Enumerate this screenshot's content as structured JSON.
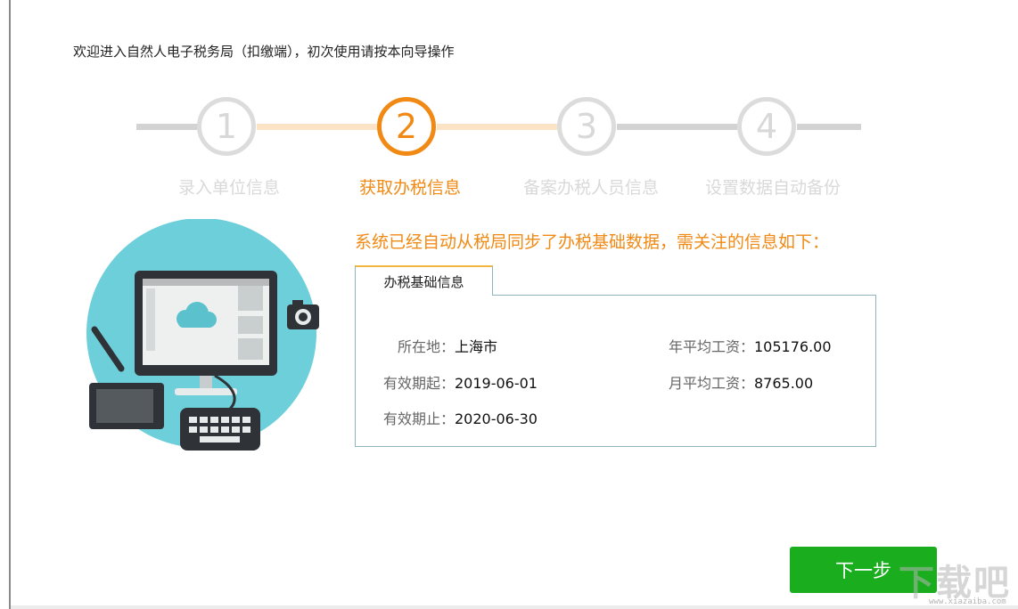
{
  "header": {
    "welcome": "欢迎进入自然人电子税务局（扣缴端），初次使用请按本向导操作"
  },
  "wizard": {
    "steps": [
      {
        "number": "1",
        "label": "录入单位信息",
        "state": "done"
      },
      {
        "number": "2",
        "label": "获取办税信息",
        "state": "active"
      },
      {
        "number": "3",
        "label": "备案办税人员信息",
        "state": "pending"
      },
      {
        "number": "4",
        "label": "设置数据自动备份",
        "state": "pending"
      }
    ],
    "colors": {
      "active": "#f08a15",
      "inactive": "#dcdcdc",
      "progress_line": "#fde3c6",
      "line": "#d3d3d3"
    }
  },
  "notice": "系统已经自动从税局同步了办税基础数据，需关注的信息如下：",
  "panel": {
    "tab_label": "办税基础信息",
    "fields": [
      {
        "key": "所在地：",
        "value": "上海市"
      },
      {
        "key": "有效期起：",
        "value": "2019-06-01"
      },
      {
        "key": "有效期止：",
        "value": "2020-06-30"
      },
      {
        "key": "年平均工资：",
        "value": "105176.00"
      },
      {
        "key": "月平均工资：",
        "value": "8765.00"
      }
    ]
  },
  "footer": {
    "next_label": "下一步",
    "next_color": "#1aae1f"
  },
  "watermark": {
    "text": "下载吧",
    "url": "www.xiazaiba.com"
  },
  "icons": [
    "computer-illustration-icon",
    "cloud-icon",
    "camera-icon",
    "pen-icon",
    "tablet-icon",
    "keyboard-icon"
  ]
}
